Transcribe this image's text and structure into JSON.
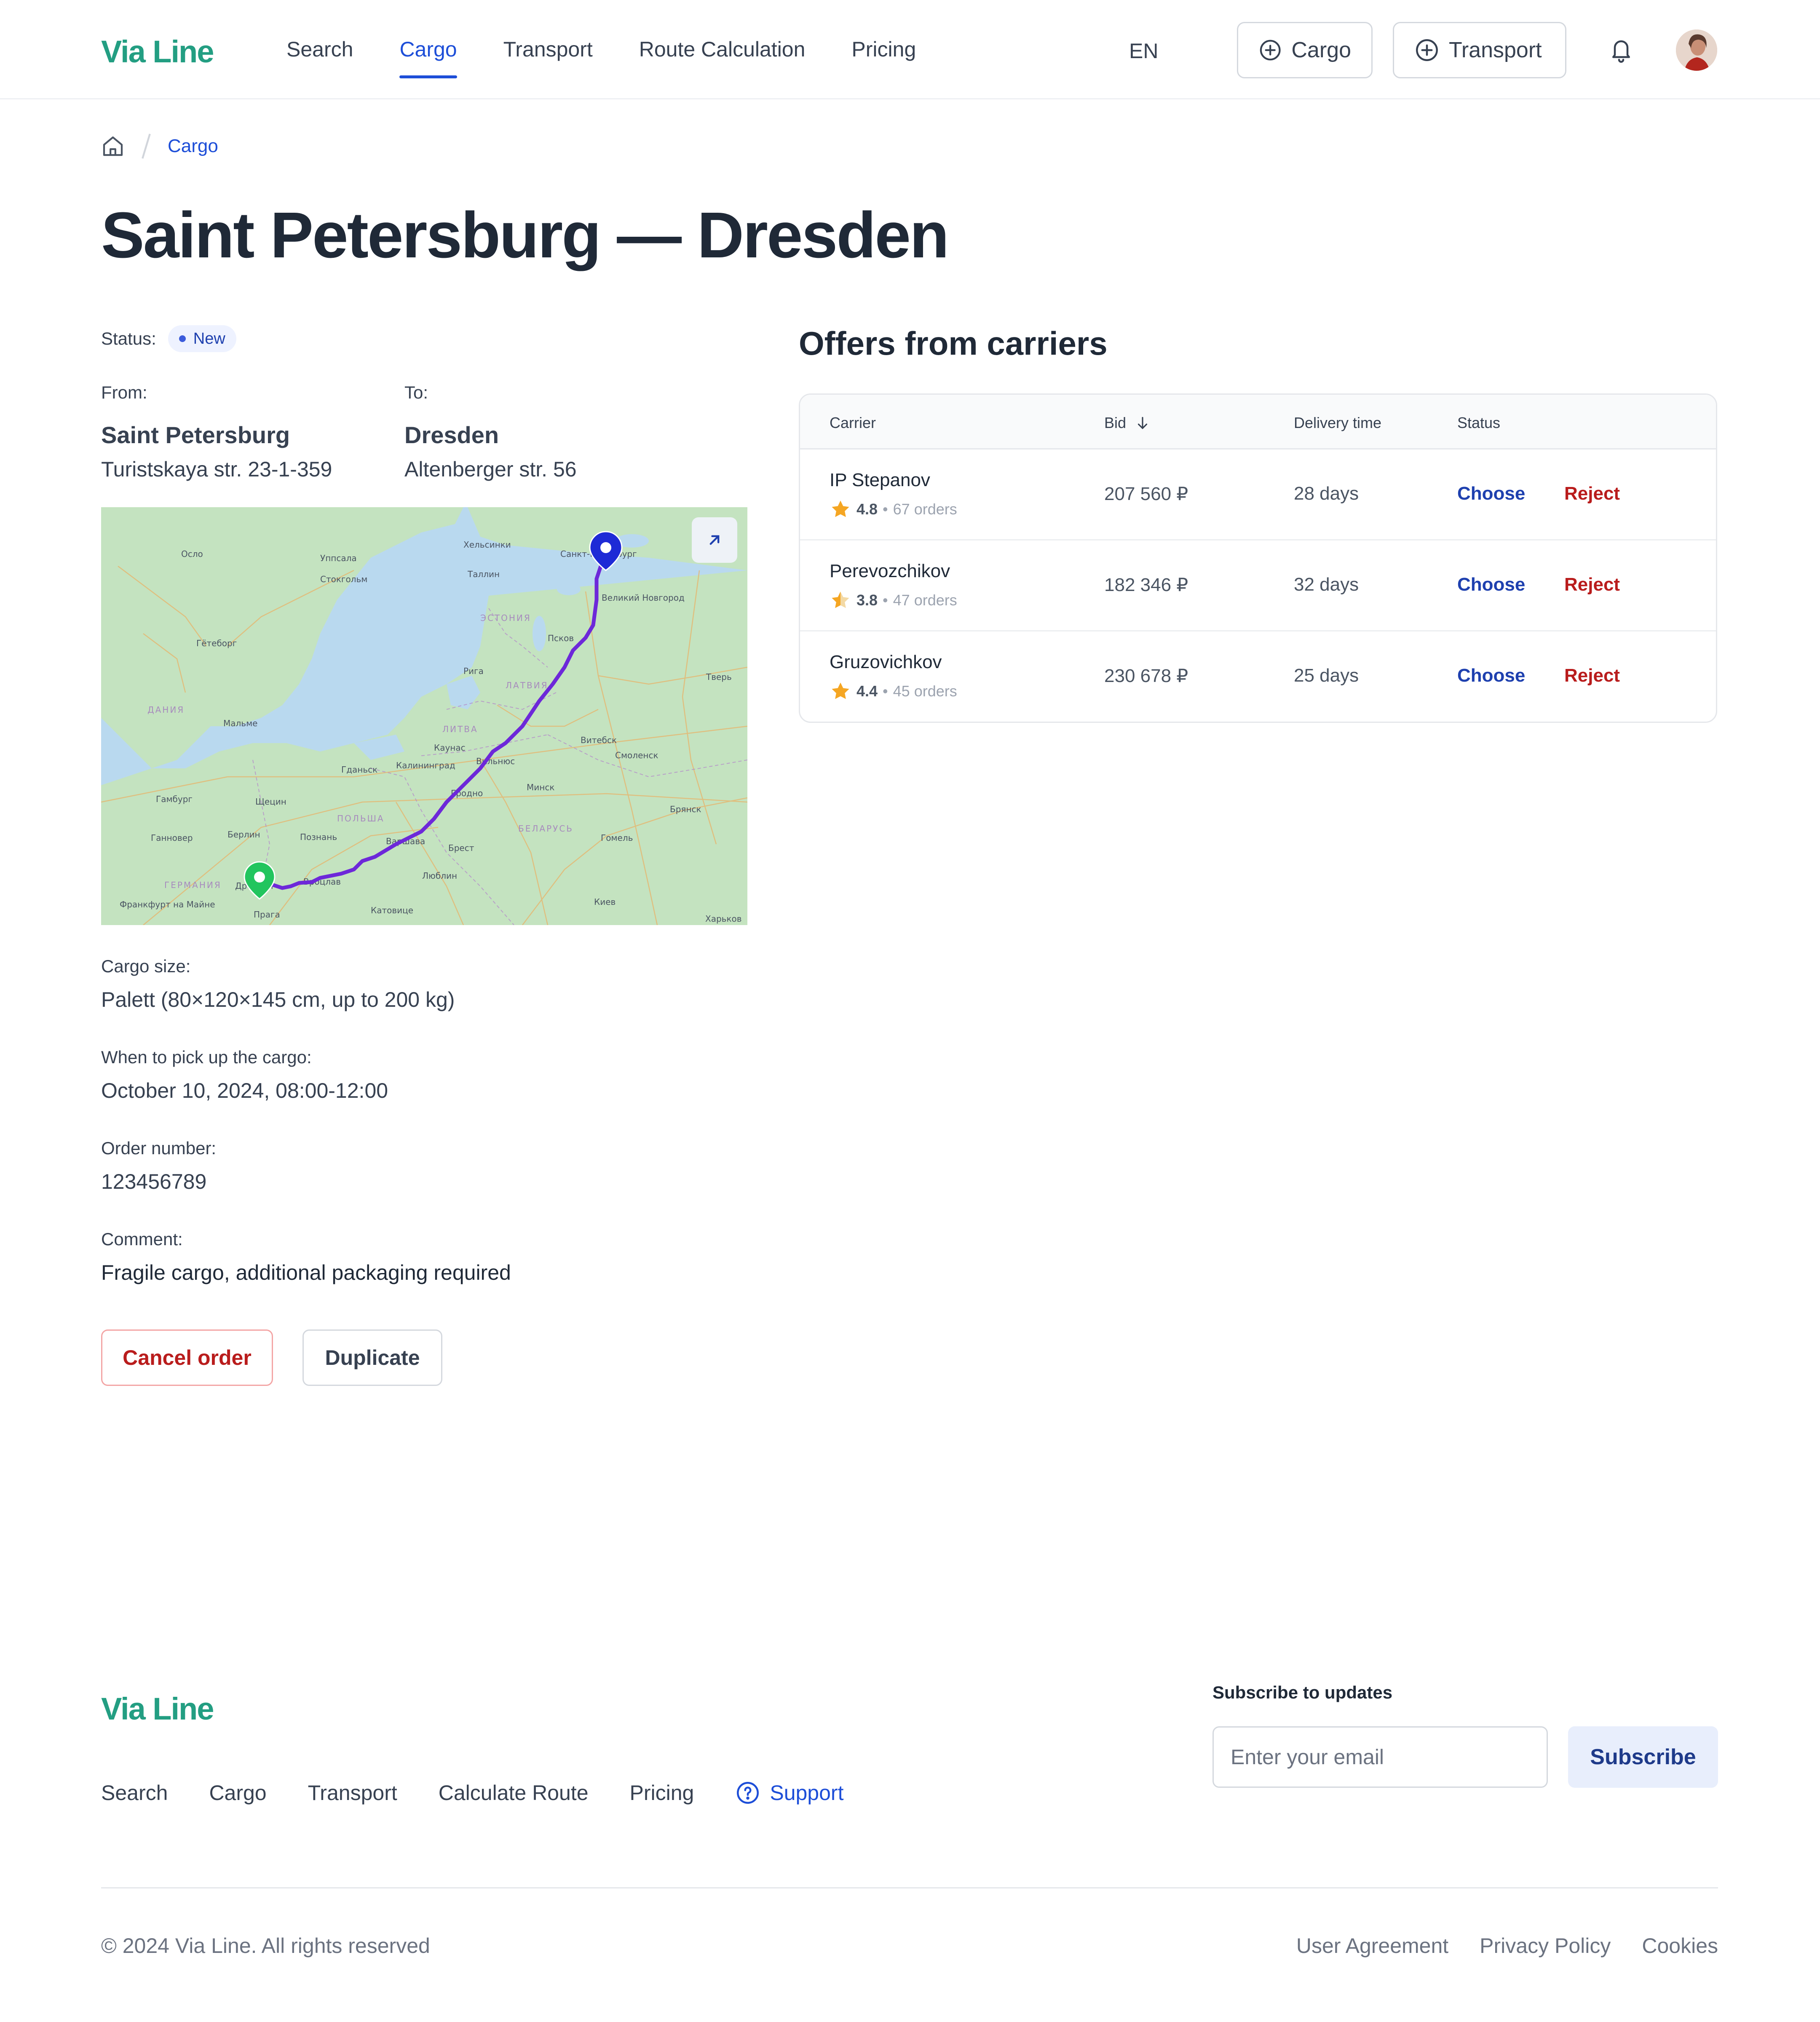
{
  "header": {
    "logo": "Via Line",
    "nav": [
      {
        "label": "Search",
        "active": false
      },
      {
        "label": "Cargo",
        "active": true
      },
      {
        "label": "Transport",
        "active": false
      },
      {
        "label": "Route Calculation",
        "active": false
      },
      {
        "label": "Pricing",
        "active": false
      }
    ],
    "language": "EN",
    "add_cargo_label": "Cargo",
    "add_transport_label": "Transport",
    "icons": {
      "add": "plus-circle-icon",
      "notifications": "bell-icon"
    }
  },
  "breadcrumb": {
    "home_icon": "home-icon",
    "current": "Cargo"
  },
  "page_title": "Saint Petersburg — Dresden",
  "order": {
    "status_label": "Status:",
    "status_value": "New",
    "from_label": "From:",
    "from_city": "Saint Petersburg",
    "from_address": "Turistskaya str. 23-1-359",
    "to_label": "To:",
    "to_city": "Dresden",
    "to_address": "Altenberger str. 56",
    "map_labels": {
      "cities": [
        "Хельсинки",
        "Санкт-Петербург",
        "Таллин",
        "Стокгольм",
        "Уппсала",
        "Осло",
        "Гётеборг",
        "Мальме",
        "Великий Новгород",
        "Псков",
        "Рига",
        "Каунас",
        "Вильнюс",
        "Калининград",
        "Гданьск",
        "Щецин",
        "Гамбург",
        "Ганновер",
        "Берлин",
        "Познань",
        "Вроцлав",
        "Катовице",
        "Прага",
        "Франкфурт на Майне",
        "Дрезден",
        "Варшава",
        "Брест",
        "Люблин",
        "Минск",
        "Гродно",
        "Витебск",
        "Смоленск",
        "Тверь",
        "Брянск",
        "Гомель",
        "Киев",
        "Харьков"
      ],
      "countries": [
        "ЭСТОНИЯ",
        "ЛАТВИЯ",
        "ЛИТВА",
        "ДАНИЯ",
        "ПОЛЬША",
        "БЕЛАРУСЬ",
        "ГЕРМАНИЯ"
      ]
    },
    "cargo_size_label": "Cargo size:",
    "cargo_size": "Palett (80×120×145 cm, up to 200 kg)",
    "pickup_label": "When to pick up the cargo:",
    "pickup": "October 10, 2024, 08:00-12:00",
    "order_number_label": "Order number:",
    "order_number": "123456789",
    "comment_label": "Comment:",
    "comment": "Fragile cargo, additional packaging required",
    "cancel_label": "Cancel order",
    "duplicate_label": "Duplicate"
  },
  "offers": {
    "title": "Offers from carriers",
    "columns": {
      "carrier": "Carrier",
      "bid": "Bid",
      "delivery": "Delivery time",
      "status": "Status"
    },
    "sort_icon": "arrow-down-icon",
    "choose_label": "Choose",
    "reject_label": "Reject",
    "rows": [
      {
        "name": "IP Stepanov",
        "rating": "4.8",
        "rating_value": 4.8,
        "orders": "67 orders",
        "bid": "207 560 ₽",
        "delivery": "28 days"
      },
      {
        "name": "Perevozchikov",
        "rating": "3.8",
        "rating_value": 3.8,
        "orders": "47 orders",
        "bid": "182 346 ₽",
        "delivery": "32 days"
      },
      {
        "name": "Gruzovichkov",
        "rating": "4.4",
        "rating_value": 4.4,
        "orders": "45 orders",
        "bid": "230 678 ₽",
        "delivery": "25 days"
      }
    ]
  },
  "footer": {
    "logo": "Via Line",
    "nav": [
      "Search",
      "Cargo",
      "Transport",
      "Calculate Route",
      "Pricing"
    ],
    "support_label": "Support",
    "subscribe_title": "Subscribe to updates",
    "email_placeholder": "Enter your email",
    "subscribe_label": "Subscribe",
    "copyright": "© 2024 Via Line. All rights reserved",
    "legal": [
      "User Agreement",
      "Privacy Policy",
      "Cookies"
    ]
  },
  "colors": {
    "brand": "#239e82",
    "accent": "#1d4ed8",
    "danger": "#b91c1c",
    "route": "#6d28d9",
    "star": "#f5a623"
  }
}
